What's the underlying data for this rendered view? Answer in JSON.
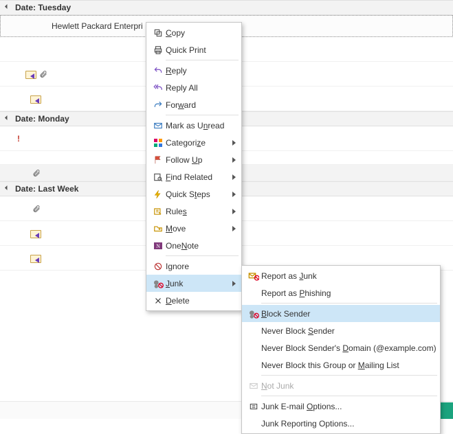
{
  "groups": [
    {
      "label": "Date: Tuesday"
    },
    {
      "label": "Date: Monday"
    },
    {
      "label": "Date: Last Week"
    }
  ],
  "rows": {
    "r1_from": "Hewlett Packard Enterpri",
    "r7_from": ""
  },
  "context_menu": {
    "copy": "Copy",
    "quick_print": "Quick Print",
    "reply": "Reply",
    "reply_all": "Reply All",
    "forward": "Forward",
    "mark_unread": "Mark as Unread",
    "categorize": "Categorize",
    "follow_up": "Follow Up",
    "find_related": "Find Related",
    "quick_steps": "Quick Steps",
    "rules": "Rules",
    "move": "Move",
    "onenote": "OneNote",
    "ignore": "Ignore",
    "junk": "Junk",
    "delete": "Delete"
  },
  "junk_submenu": {
    "report_junk": "Report as Junk",
    "report_phishing": "Report as Phishing",
    "block_sender": "Block Sender",
    "never_block_sender": "Never Block Sender",
    "never_block_domain": "Never Block Sender's Domain (@example.com)",
    "never_block_group": "Never Block this Group or Mailing List",
    "not_junk": "Not Junk",
    "junk_options": "Junk E-mail Options...",
    "junk_reporting": "Junk Reporting Options..."
  }
}
